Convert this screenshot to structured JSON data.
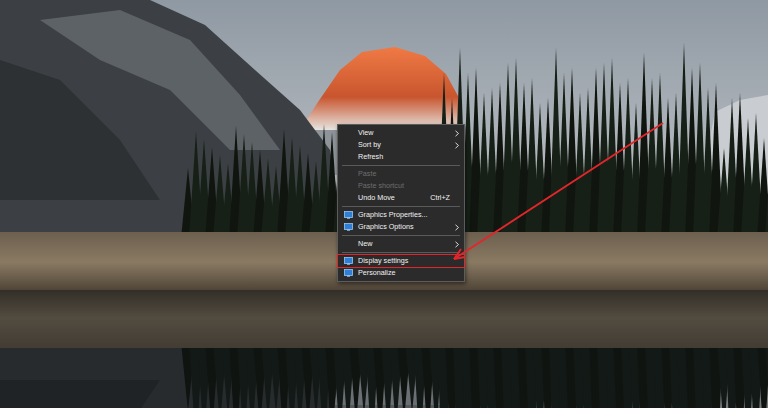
{
  "desktop": {
    "context_menu": {
      "items": [
        {
          "kind": "item",
          "label": "View",
          "shortcut": "",
          "submenu": true,
          "disabled": false,
          "icon": false,
          "annotated": false
        },
        {
          "kind": "item",
          "label": "Sort by",
          "shortcut": "",
          "submenu": true,
          "disabled": false,
          "icon": false,
          "annotated": false
        },
        {
          "kind": "item",
          "label": "Refresh",
          "shortcut": "",
          "submenu": false,
          "disabled": false,
          "icon": false,
          "annotated": false
        },
        {
          "kind": "separator"
        },
        {
          "kind": "item",
          "label": "Paste",
          "shortcut": "",
          "submenu": false,
          "disabled": true,
          "icon": false,
          "annotated": false
        },
        {
          "kind": "item",
          "label": "Paste shortcut",
          "shortcut": "",
          "submenu": false,
          "disabled": true,
          "icon": false,
          "annotated": false
        },
        {
          "kind": "item",
          "label": "Undo Move",
          "shortcut": "Ctrl+Z",
          "submenu": false,
          "disabled": false,
          "icon": false,
          "annotated": false
        },
        {
          "kind": "separator"
        },
        {
          "kind": "item",
          "label": "Graphics Properties...",
          "shortcut": "",
          "submenu": false,
          "disabled": false,
          "icon": true,
          "annotated": false
        },
        {
          "kind": "item",
          "label": "Graphics Options",
          "shortcut": "",
          "submenu": true,
          "disabled": false,
          "icon": true,
          "annotated": false
        },
        {
          "kind": "separator"
        },
        {
          "kind": "item",
          "label": "New",
          "shortcut": "",
          "submenu": true,
          "disabled": false,
          "icon": false,
          "annotated": false
        },
        {
          "kind": "separator"
        },
        {
          "kind": "item",
          "label": "Display settings",
          "shortcut": "",
          "submenu": false,
          "disabled": false,
          "icon": true,
          "annotated": true
        },
        {
          "kind": "item",
          "label": "Personalize",
          "shortcut": "",
          "submenu": false,
          "disabled": false,
          "icon": true,
          "annotated": false
        }
      ]
    }
  }
}
